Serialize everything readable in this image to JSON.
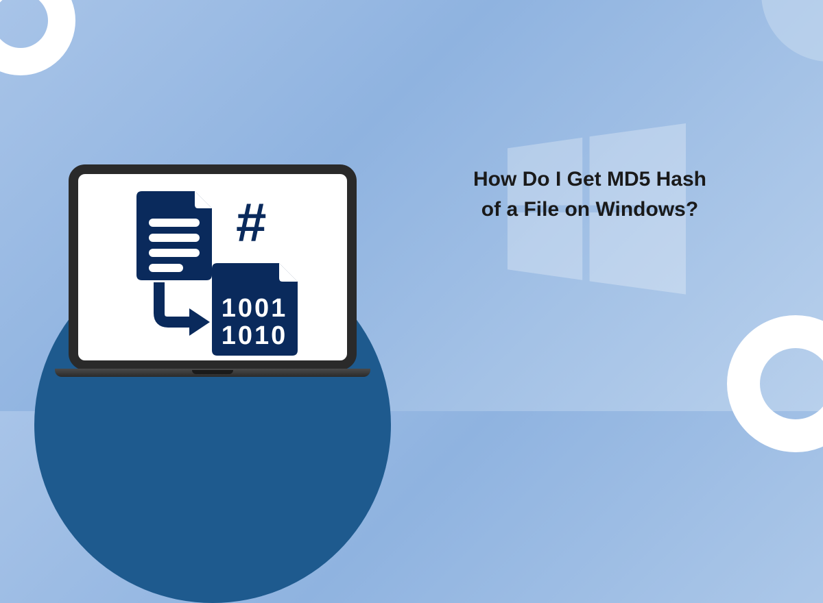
{
  "headline": {
    "line1": "How Do I Get MD5 Hash",
    "line2": "of a File on Windows?"
  },
  "colors": {
    "icon_navy": "#0a2a5c",
    "pedestal": "#1e5a8e",
    "laptop_frame": "#2a2a2a"
  }
}
